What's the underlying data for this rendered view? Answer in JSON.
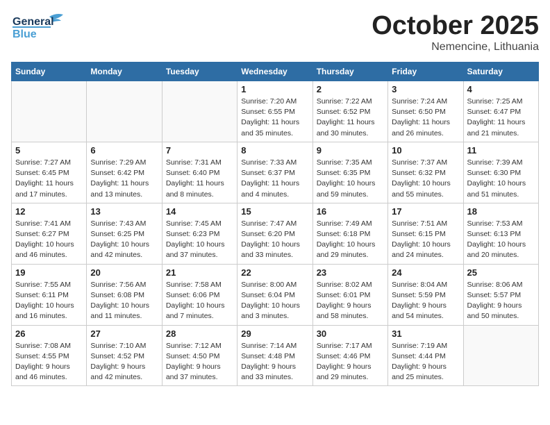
{
  "header": {
    "logo_line1": "General",
    "logo_line2": "Blue",
    "month": "October 2025",
    "location": "Nemencine, Lithuania"
  },
  "weekdays": [
    "Sunday",
    "Monday",
    "Tuesday",
    "Wednesday",
    "Thursday",
    "Friday",
    "Saturday"
  ],
  "weeks": [
    [
      {
        "day": "",
        "info": ""
      },
      {
        "day": "",
        "info": ""
      },
      {
        "day": "",
        "info": ""
      },
      {
        "day": "1",
        "info": "Sunrise: 7:20 AM\nSunset: 6:55 PM\nDaylight: 11 hours\nand 35 minutes."
      },
      {
        "day": "2",
        "info": "Sunrise: 7:22 AM\nSunset: 6:52 PM\nDaylight: 11 hours\nand 30 minutes."
      },
      {
        "day": "3",
        "info": "Sunrise: 7:24 AM\nSunset: 6:50 PM\nDaylight: 11 hours\nand 26 minutes."
      },
      {
        "day": "4",
        "info": "Sunrise: 7:25 AM\nSunset: 6:47 PM\nDaylight: 11 hours\nand 21 minutes."
      }
    ],
    [
      {
        "day": "5",
        "info": "Sunrise: 7:27 AM\nSunset: 6:45 PM\nDaylight: 11 hours\nand 17 minutes."
      },
      {
        "day": "6",
        "info": "Sunrise: 7:29 AM\nSunset: 6:42 PM\nDaylight: 11 hours\nand 13 minutes."
      },
      {
        "day": "7",
        "info": "Sunrise: 7:31 AM\nSunset: 6:40 PM\nDaylight: 11 hours\nand 8 minutes."
      },
      {
        "day": "8",
        "info": "Sunrise: 7:33 AM\nSunset: 6:37 PM\nDaylight: 11 hours\nand 4 minutes."
      },
      {
        "day": "9",
        "info": "Sunrise: 7:35 AM\nSunset: 6:35 PM\nDaylight: 10 hours\nand 59 minutes."
      },
      {
        "day": "10",
        "info": "Sunrise: 7:37 AM\nSunset: 6:32 PM\nDaylight: 10 hours\nand 55 minutes."
      },
      {
        "day": "11",
        "info": "Sunrise: 7:39 AM\nSunset: 6:30 PM\nDaylight: 10 hours\nand 51 minutes."
      }
    ],
    [
      {
        "day": "12",
        "info": "Sunrise: 7:41 AM\nSunset: 6:27 PM\nDaylight: 10 hours\nand 46 minutes."
      },
      {
        "day": "13",
        "info": "Sunrise: 7:43 AM\nSunset: 6:25 PM\nDaylight: 10 hours\nand 42 minutes."
      },
      {
        "day": "14",
        "info": "Sunrise: 7:45 AM\nSunset: 6:23 PM\nDaylight: 10 hours\nand 37 minutes."
      },
      {
        "day": "15",
        "info": "Sunrise: 7:47 AM\nSunset: 6:20 PM\nDaylight: 10 hours\nand 33 minutes."
      },
      {
        "day": "16",
        "info": "Sunrise: 7:49 AM\nSunset: 6:18 PM\nDaylight: 10 hours\nand 29 minutes."
      },
      {
        "day": "17",
        "info": "Sunrise: 7:51 AM\nSunset: 6:15 PM\nDaylight: 10 hours\nand 24 minutes."
      },
      {
        "day": "18",
        "info": "Sunrise: 7:53 AM\nSunset: 6:13 PM\nDaylight: 10 hours\nand 20 minutes."
      }
    ],
    [
      {
        "day": "19",
        "info": "Sunrise: 7:55 AM\nSunset: 6:11 PM\nDaylight: 10 hours\nand 16 minutes."
      },
      {
        "day": "20",
        "info": "Sunrise: 7:56 AM\nSunset: 6:08 PM\nDaylight: 10 hours\nand 11 minutes."
      },
      {
        "day": "21",
        "info": "Sunrise: 7:58 AM\nSunset: 6:06 PM\nDaylight: 10 hours\nand 7 minutes."
      },
      {
        "day": "22",
        "info": "Sunrise: 8:00 AM\nSunset: 6:04 PM\nDaylight: 10 hours\nand 3 minutes."
      },
      {
        "day": "23",
        "info": "Sunrise: 8:02 AM\nSunset: 6:01 PM\nDaylight: 9 hours\nand 58 minutes."
      },
      {
        "day": "24",
        "info": "Sunrise: 8:04 AM\nSunset: 5:59 PM\nDaylight: 9 hours\nand 54 minutes."
      },
      {
        "day": "25",
        "info": "Sunrise: 8:06 AM\nSunset: 5:57 PM\nDaylight: 9 hours\nand 50 minutes."
      }
    ],
    [
      {
        "day": "26",
        "info": "Sunrise: 7:08 AM\nSunset: 4:55 PM\nDaylight: 9 hours\nand 46 minutes."
      },
      {
        "day": "27",
        "info": "Sunrise: 7:10 AM\nSunset: 4:52 PM\nDaylight: 9 hours\nand 42 minutes."
      },
      {
        "day": "28",
        "info": "Sunrise: 7:12 AM\nSunset: 4:50 PM\nDaylight: 9 hours\nand 37 minutes."
      },
      {
        "day": "29",
        "info": "Sunrise: 7:14 AM\nSunset: 4:48 PM\nDaylight: 9 hours\nand 33 minutes."
      },
      {
        "day": "30",
        "info": "Sunrise: 7:17 AM\nSunset: 4:46 PM\nDaylight: 9 hours\nand 29 minutes."
      },
      {
        "day": "31",
        "info": "Sunrise: 7:19 AM\nSunset: 4:44 PM\nDaylight: 9 hours\nand 25 minutes."
      },
      {
        "day": "",
        "info": ""
      }
    ]
  ]
}
